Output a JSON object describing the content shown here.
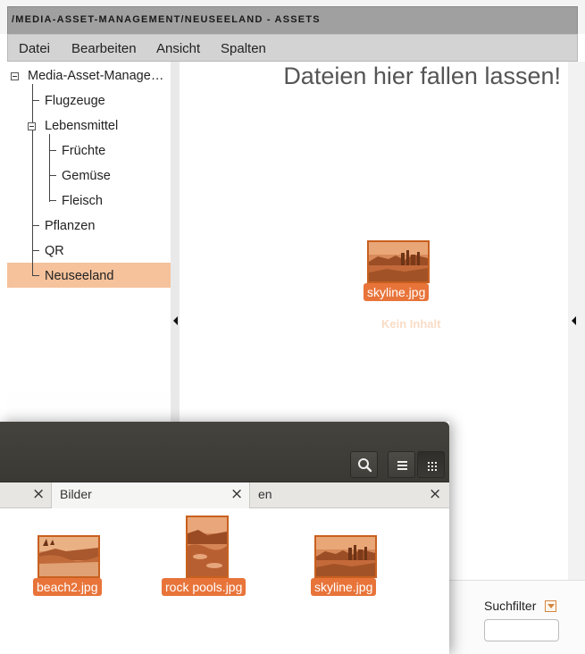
{
  "window": {
    "title": "/MEDIA-ASSET-MANAGEMENT/NEUSEELAND - ASSETS"
  },
  "menu": {
    "items": [
      "Datei",
      "Bearbeiten",
      "Ansicht",
      "Spalten"
    ]
  },
  "tree": {
    "root": "Media-Asset-Manage…",
    "items": [
      "Flugzeuge",
      "Lebensmittel",
      "Früchte",
      "Gemüse",
      "Fleisch",
      "Pflanzen",
      "QR",
      "Neuseeland"
    ],
    "selected": "Neuseeland"
  },
  "main": {
    "drop_hint": "Dateien hier fallen lassen!",
    "empty_hint": "Kein Inhalt",
    "files": [
      "skyline.jpg"
    ]
  },
  "filter": {
    "label": "Suchfilter",
    "value": ""
  },
  "file_manager": {
    "tabs": [
      {
        "label": "",
        "active": false
      },
      {
        "label": "Bilder",
        "active": true
      },
      {
        "label": "en",
        "active": false
      }
    ],
    "files": [
      "beach2.jpg",
      "rock pools.jpg",
      "skyline.jpg"
    ],
    "header_icons": [
      "search-icon",
      "list-view-icon",
      "grid-view-icon"
    ]
  },
  "colors": {
    "accent": "#e8743a",
    "selection": "#f5c29b",
    "titlebar": "#a0a0a0",
    "menubar": "#d3d3d3",
    "fm_header": "#3f3d38"
  }
}
